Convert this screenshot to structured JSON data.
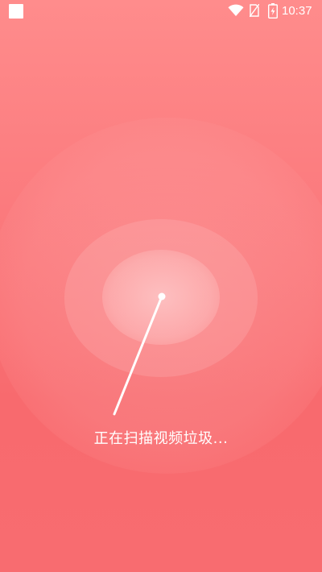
{
  "status_bar": {
    "time": "10:37",
    "icons": [
      "app-square-icon",
      "wifi-icon",
      "no-sim-icon",
      "battery-charging-icon"
    ]
  },
  "scanner": {
    "status_text": "正在扫描视频垃圾..."
  },
  "colors": {
    "background_top": "#ff8c8c",
    "background_bottom": "#f86c70",
    "foreground": "#ffffff"
  }
}
